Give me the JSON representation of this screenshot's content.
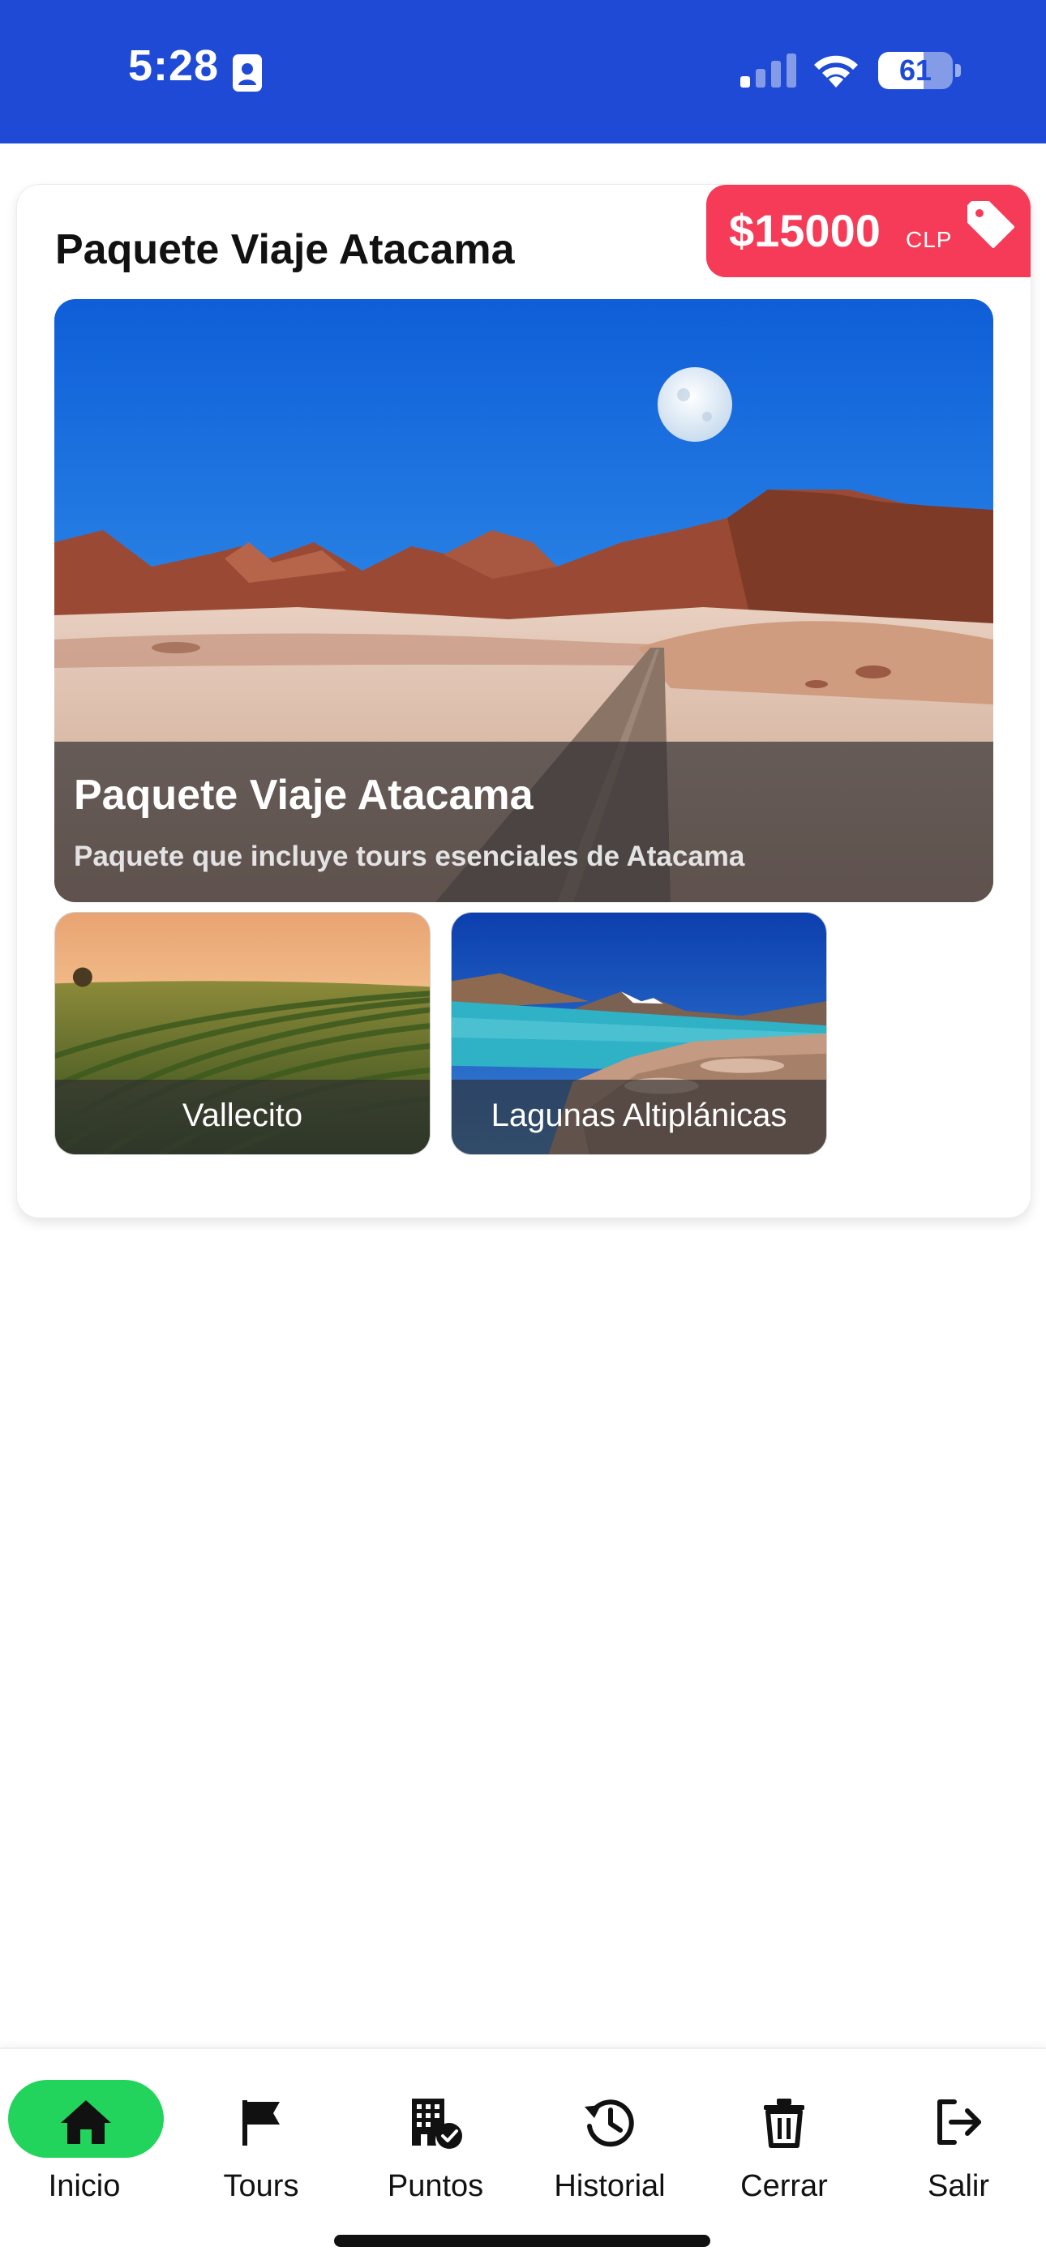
{
  "status_bar": {
    "time": "5:28",
    "battery_level": "61",
    "battery_fraction": 0.61,
    "background_color": "#1f4ad6",
    "icons": [
      "contact-card-icon",
      "cellular-signal-icon",
      "wifi-icon",
      "battery-icon"
    ]
  },
  "package": {
    "title": "Paquete Viaje Atacama",
    "price": {
      "amount": "$15000",
      "currency": "CLP",
      "background_color": "#f53b57",
      "icon": "price-tag-icon"
    },
    "hero": {
      "title": "Paquete Viaje Atacama",
      "subtitle": "Paquete que incluye tours esenciales de Atacama",
      "image_alt": "Valle de la Luna desert road under a blue sky with the moon"
    },
    "tours": [
      {
        "label": "Vallecito",
        "image_alt": "Vineyard rows at sunset"
      },
      {
        "label": "Lagunas Altiplánicas",
        "image_alt": "Altiplanic lagoon with snow-capped volcano"
      }
    ]
  },
  "bottom_nav": {
    "active_color": "#22d45c",
    "items": [
      {
        "label": "Inicio",
        "icon": "home-icon",
        "active": true
      },
      {
        "label": "Tours",
        "icon": "flag-icon",
        "active": false
      },
      {
        "label": "Puntos",
        "icon": "building-check-icon",
        "active": false
      },
      {
        "label": "Historial",
        "icon": "history-icon",
        "active": false
      },
      {
        "label": "Cerrar",
        "icon": "trash-icon",
        "active": false
      },
      {
        "label": "Salir",
        "icon": "logout-icon",
        "active": false
      }
    ]
  }
}
